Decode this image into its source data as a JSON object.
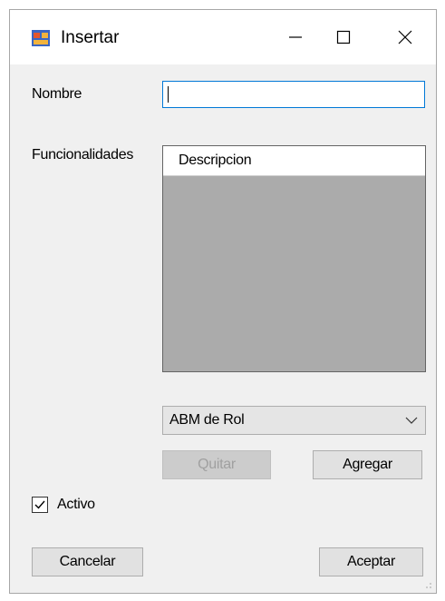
{
  "window": {
    "title": "Insertar",
    "icon": "form-window-icon",
    "controls": {
      "minimize": "minimize-icon",
      "maximize": "maximize-icon",
      "close": "close-icon"
    }
  },
  "form": {
    "nombre_label": "Nombre",
    "nombre_value": "",
    "funcionalidades_label": "Funcionalidades",
    "grid": {
      "columns": [
        "Descripcion"
      ],
      "rows": []
    },
    "combo": {
      "selected": "ABM de Rol",
      "arrow_icon": "chevron-down-icon"
    },
    "quitar_label": "Quitar",
    "agregar_label": "Agregar",
    "activo_label": "Activo",
    "activo_checked": true,
    "cancelar_label": "Cancelar",
    "aceptar_label": "Aceptar"
  },
  "colors": {
    "focus_border": "#0078d7",
    "grid_background": "#ababab",
    "window_background": "#f0f0f0"
  }
}
